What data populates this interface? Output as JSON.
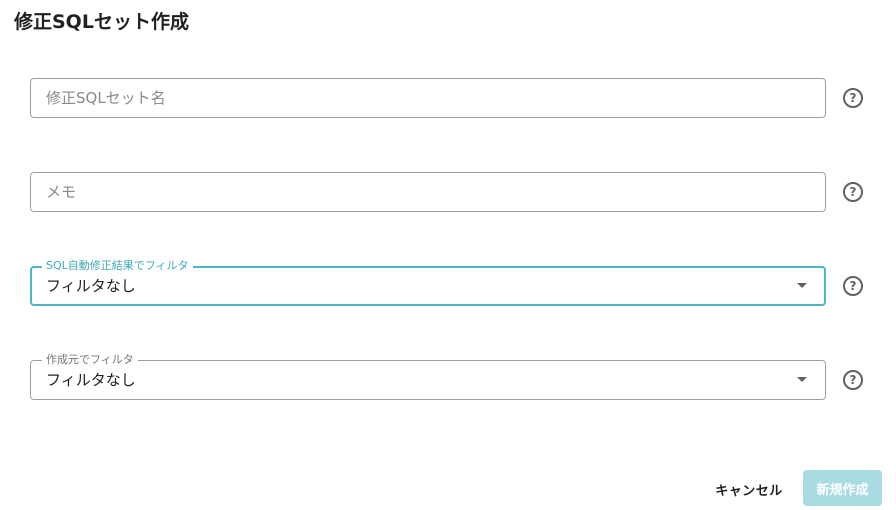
{
  "dialog": {
    "title": "修正SQLセット作成"
  },
  "fields": {
    "name": {
      "placeholder": "修正SQLセット名",
      "value": ""
    },
    "memo": {
      "placeholder": "メモ",
      "value": ""
    },
    "auto_fix_filter": {
      "label": "SQL自動修正結果でフィルタ",
      "value": "フィルタなし"
    },
    "origin_filter": {
      "label": "作成元でフィルタ",
      "value": "フィルタなし"
    }
  },
  "help_icon_glyph": "?",
  "actions": {
    "cancel_label": "キャンセル",
    "create_label": "新規作成"
  },
  "colors": {
    "accent": "#4db6c5",
    "create_disabled_bg": "#a8dbe2"
  }
}
